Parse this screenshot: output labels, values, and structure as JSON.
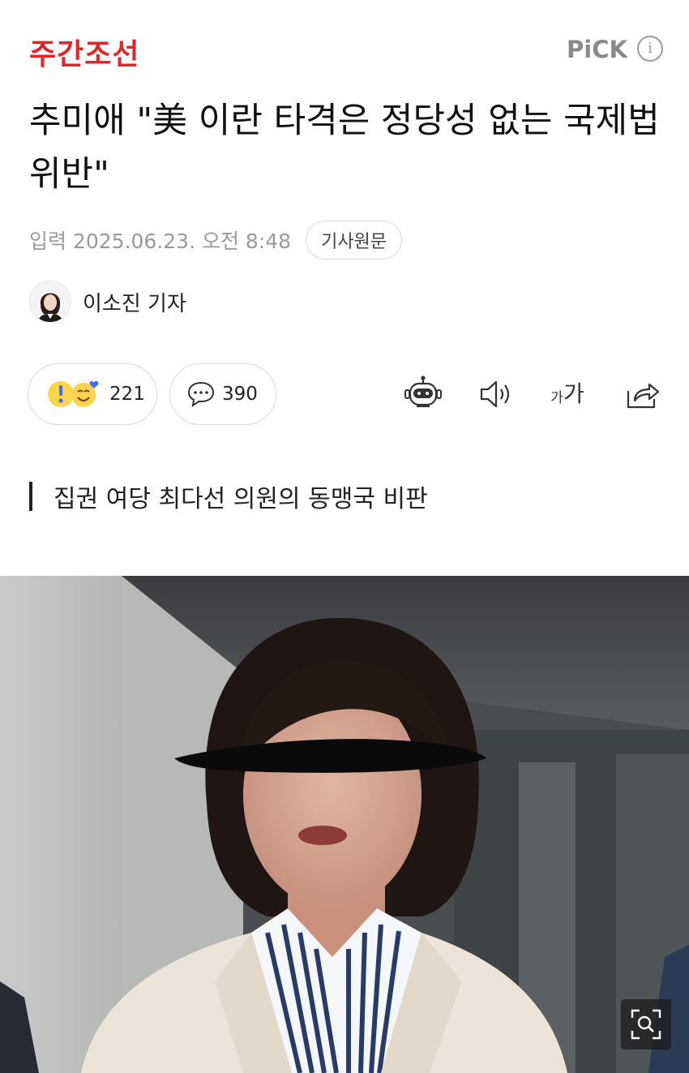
{
  "header": {
    "logo": "주간조선",
    "pick_label": "PiCK",
    "info_glyph": "i"
  },
  "article": {
    "title": "추미애 \"美 이란 타격은 정당성 없는 국제법 위반\"",
    "published": "입력 2025.06.23. 오전 8:48",
    "original_link_label": "기사원문",
    "author": "이소진 기자",
    "subtitle": "집권 여당 최다선 의원의 동맹국 비판"
  },
  "actions": {
    "reaction_count": "221",
    "comment_count": "390",
    "font_size_label_small": "가",
    "font_size_label_large": "가"
  },
  "colors": {
    "brand_red": "#e0262b",
    "muted_gray": "#9a9a9a"
  },
  "icons": [
    "info-icon",
    "reaction-icon",
    "comment-icon",
    "summary-bot-icon",
    "speaker-icon",
    "font-size-icon",
    "share-icon",
    "zoom-icon"
  ]
}
